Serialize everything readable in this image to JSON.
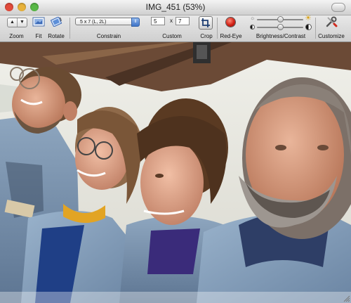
{
  "window": {
    "title": "IMG_451 (53%)"
  },
  "toolbar": {
    "zoom": {
      "label": "Zoom",
      "up_glyph": "▲",
      "down_glyph": "▼"
    },
    "fit": {
      "label": "Fit",
      "icon": "fit-icon"
    },
    "rotate": {
      "label": "Rotate",
      "icon": "rotate-icon"
    },
    "constrain": {
      "label": "Constrain",
      "selected": "5 x 7  (L, 2L)"
    },
    "custom": {
      "label": "Custom",
      "width": "5",
      "height": "7",
      "separator": "x"
    },
    "crop": {
      "label": "Crop",
      "icon": "crop-icon"
    },
    "red_eye": {
      "label": "Red-Eye",
      "icon": "red-eye-icon"
    },
    "brightness_contrast": {
      "label": "Brightness/Contrast",
      "brightness_level": 0.5,
      "contrast_level": 0.5
    },
    "customize": {
      "label": "Customize",
      "icon": "wrench-screwdriver-icon"
    }
  },
  "photo": {
    "description_icon": "photo-of-four-people-looking-up",
    "zoom_percent": 53
  },
  "colors": {
    "redeye_red": "#d11f13",
    "select_blue": "#3e74c8",
    "toolbar_bg": "#d9d9d9"
  }
}
